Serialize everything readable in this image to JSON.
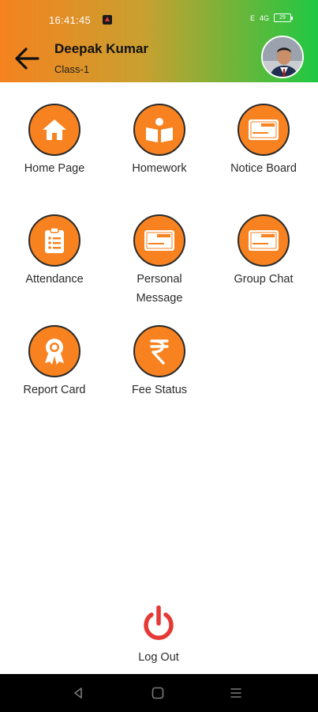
{
  "status_bar": {
    "time": "16:41:45",
    "sim_label": "E",
    "signal_label": "4G",
    "battery": "29"
  },
  "header": {
    "name": "Deepak Kumar",
    "class_label": "Class-1"
  },
  "menu": [
    {
      "label": "Home Page",
      "icon": "home-icon"
    },
    {
      "label": "Homework",
      "icon": "book-reader-icon"
    },
    {
      "label": "Notice Board",
      "icon": "card-icon"
    },
    {
      "label": "Attendance",
      "icon": "clipboard-list-icon"
    },
    {
      "label": "Personal\nMessage",
      "icon": "card-icon"
    },
    {
      "label": "Group Chat",
      "icon": "card-icon"
    },
    {
      "label": "Report Card",
      "icon": "award-icon"
    },
    {
      "label": "Fee Status",
      "icon": "rupee-icon"
    }
  ],
  "logout": {
    "label": "Log Out",
    "icon": "power-icon",
    "color": "#e53935"
  },
  "colors": {
    "header_gradient_start": "#f5821f",
    "header_gradient_end": "#1ec843",
    "icon_circle": "#f7821f"
  }
}
